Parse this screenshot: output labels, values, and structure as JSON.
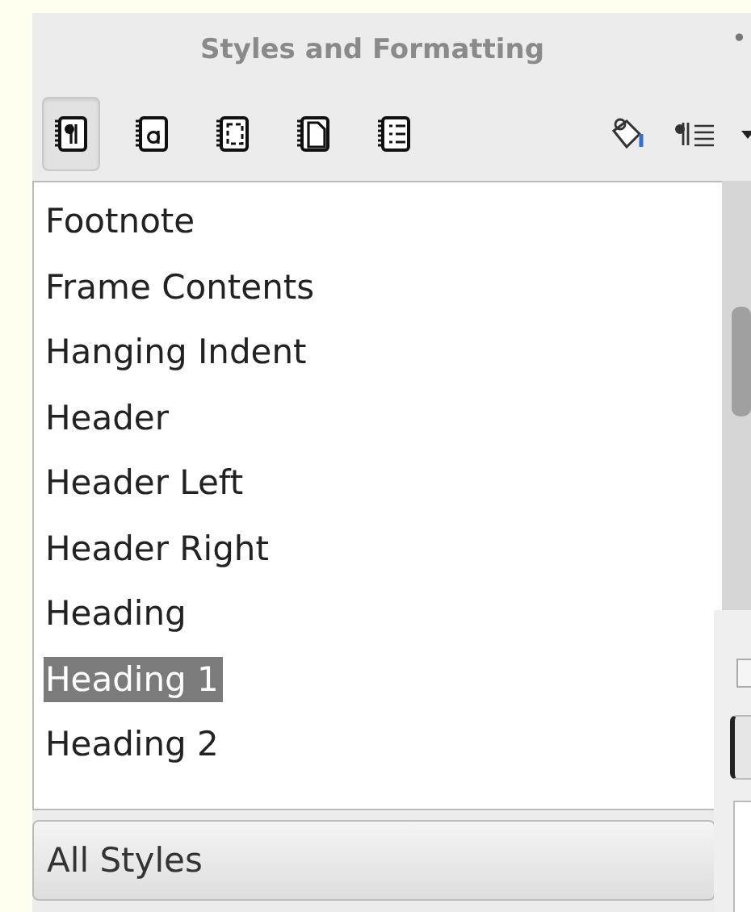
{
  "panel": {
    "title": "Styles and Formatting",
    "menu_glyph": "•"
  },
  "style_families": [
    {
      "selected": true
    },
    {
      "selected": false
    },
    {
      "selected": false
    },
    {
      "selected": false
    },
    {
      "selected": false
    }
  ],
  "styles": [
    {
      "label": "Footnote",
      "selected": false
    },
    {
      "label": "Frame Contents",
      "selected": false
    },
    {
      "label": "Hanging Indent",
      "selected": false
    },
    {
      "label": "Header",
      "selected": false
    },
    {
      "label": "Header Left",
      "selected": false
    },
    {
      "label": "Header Right",
      "selected": false
    },
    {
      "label": "Heading",
      "selected": false
    },
    {
      "label": "Heading 1",
      "selected": true
    },
    {
      "label": "Heading 2",
      "selected": false
    }
  ],
  "filter": {
    "value": "All Styles"
  }
}
